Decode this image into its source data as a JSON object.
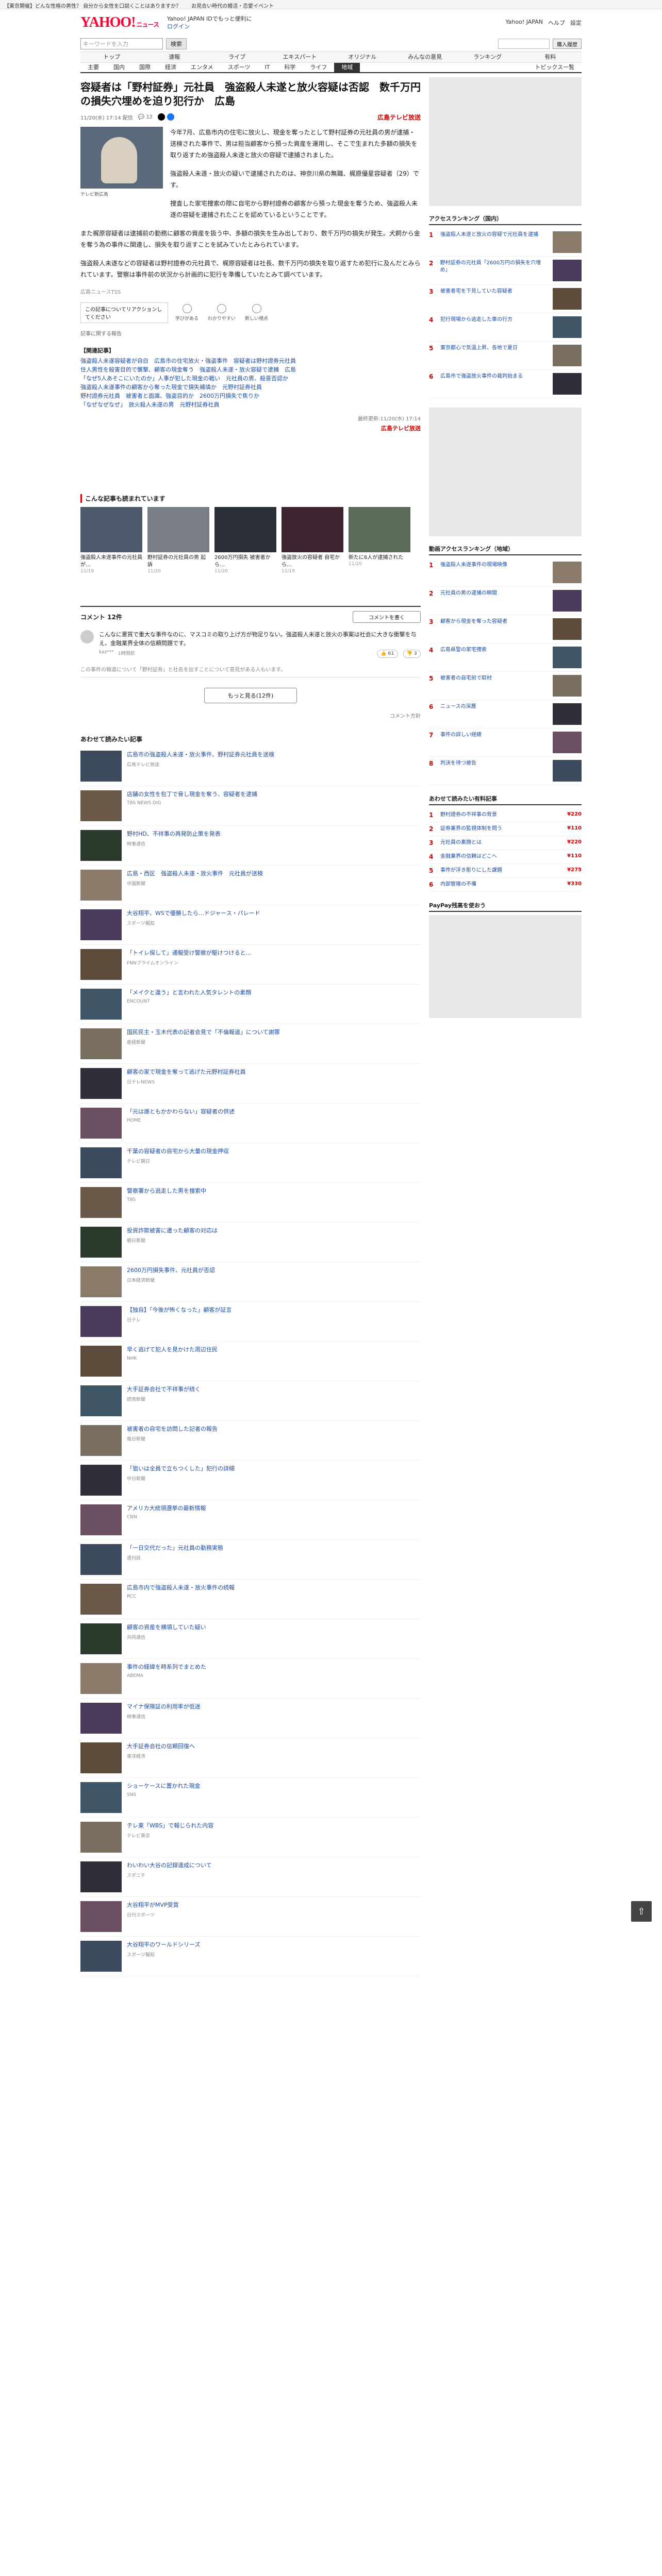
{
  "topbanner": {
    "left": "【東京開催】どんな性格の男性？ 自分から女性を口説くことはありますか？",
    "right": "お見合い時代の婚活・恋愛イベント"
  },
  "masthead": {
    "logo": "YAHOO!",
    "logo_sub": "ニュース",
    "links": [
      "Yahoo! JAPAN IDでもっと便利に",
      "ログイン"
    ],
    "right_links": [
      "Yahoo! JAPAN",
      "ヘルプ",
      "設定"
    ]
  },
  "search": {
    "placeholder": "キーワードを入力",
    "button": "検索",
    "right_button": "購入履歴"
  },
  "nav1": [
    "トップ",
    "速報",
    "ライブ",
    "エキスパート",
    "オリジナル",
    "みんなの意見",
    "ランキング",
    "有料"
  ],
  "nav2": {
    "items": [
      "主要",
      "国内",
      "国際",
      "経済",
      "エンタメ",
      "スポーツ",
      "IT",
      "科学",
      "ライフ",
      "地域"
    ],
    "active_index": 9,
    "favorite": "トピックス一覧"
  },
  "article": {
    "headline": "容疑者は「野村証券」元社員　強盗殺人未遂と放火容疑は否認　数千万円の損失穴埋めを迫り犯行か　広島",
    "date": "11/20(水) 17:14 配信",
    "comment_count": "12",
    "source": "広島テレビ放送",
    "photo_caption": "テレビ新広島",
    "paragraphs": [
      "今年7月、広島市内の住宅に放火し、現金を奪ったとして野村証券の元社員の男が逮捕・送検された事件で、男は担当顧客から預った資産を運用し、そこで生まれた多額の損失を取り返すため強盗殺人未遂と放火の容疑で逮捕されました。",
      "強盗殺人未遂・放火の疑いで逮捕されたのは、神奈川県の無職、梶原優星容疑者（29）です。",
      "捜査した家宅捜索の際に自宅から野村證券の顧客から預った現金を奪うため、強盗殺人未遂の容疑を逮捕されたことを認めているということです。"
    ],
    "full_paragraphs": [
      "また梶原容疑者は逮捕前の勤務に顧客の資産を扱う中、多額の損失を生み出しており、数千万円の損失が発生。犬飼から金を奪う為の事件に関連し、損失を取り返すことを試みていたとみられています。",
      "強盗殺人未遂などの容疑者は野村證券の元社員で、梶原容疑者は社長、数千万円の損失を取り返すため犯行に及んだとみられています。警察は事件前の状況から計画的に犯行を準備していたとみて調べています。"
    ],
    "small_source": "広島ニュースTSS",
    "reactions": {
      "prompt": "この記事についてリアクションしてください",
      "items": [
        "学びがある",
        "わかりやすい",
        "新しい視点"
      ]
    },
    "report": "記事に関する報告",
    "related_title": "【関連記事】",
    "related": [
      "強盗殺人未遂容疑者が自白　広島市の住宅放火・強盗事件　容疑者は野村證券元社員",
      "住人男性を殺害目的で襲撃、顧客の現金奪う　強盗殺人未遂・放火容疑で逮捕　広島",
      "「なぜ5人あそこにいたのか」人事が犯した現金の戦い　元社員の男、殺意否認か",
      "強盗殺人未遂事件の顧客から奪った現金で損失補填か　元野村証券社員",
      "野村證券元社員　被害者と面識、強盗目的か　2600万円損失で焦りか",
      "「なぜなぜなぜ」　放火殺人未遂の男　元野村証券社員"
    ],
    "footnote": "最終更新:11/20(水) 17:14",
    "brand_footer": "広島テレビ放送"
  },
  "also_read": {
    "title": "こんな記事も読まれています",
    "cards": [
      {
        "title": "強盗殺人未遂事件の元社員が…",
        "time": "11/19"
      },
      {
        "title": "野村証券の元社員の男 起訴",
        "time": "11/20"
      },
      {
        "title": "2600万円損失 被害者から…",
        "time": "11/20"
      },
      {
        "title": "強盗放火の容疑者 自宅から…",
        "time": "11/19"
      },
      {
        "title": "新たに6人が逮捕された",
        "time": "11/20"
      }
    ]
  },
  "comments": {
    "title": "コメント 12件",
    "write_button": "コメントを書く",
    "first": {
      "text": "こんなに悪質で重大な事件なのに、マスコミの取り上げ方が物足りない。強盗殺人未遂と放火の事案は社会に大きな衝撃を与え、金融業界全体の信頼問題です。",
      "user": "kaz***",
      "time": "1時間前",
      "likes": "61",
      "dislikes": "3"
    },
    "policy": "この事件の報道について「野村証券」と社名を出すことについて意見がある人もいます。",
    "more_button": "もっと見る(12件)",
    "policy_link": "コメント方針"
  },
  "more_list": {
    "title": "あわせて読みたい記事",
    "items": [
      {
        "title": "広島市の強盗殺人未遂・放火事件、野村証券元社員を送検",
        "meta": "広島テレビ放送"
      },
      {
        "title": "店舗の女性を包丁で脅し現金を奪う、容疑者を逮捕",
        "meta": "TBS NEWS DIG"
      },
      {
        "title": "野村HD、不祥事の再発防止策を発表",
        "meta": "時事通信"
      },
      {
        "title": "広島・西区　強盗殺人未遂・放火事件　元社員が送検",
        "meta": "中国新聞"
      },
      {
        "title": "大谷翔平、WSで優勝したら…ドジャース・パレード",
        "meta": "スポーツ報知"
      },
      {
        "title": "「トイレ探して」通報受け警察が駆けつけると…",
        "meta": "FNNプライムオンライン"
      },
      {
        "title": "「メイクと違う」と言われた人気タレントの素顔",
        "meta": "ENCOUNT"
      },
      {
        "title": "国民民主・玉木代表の記者会見で「不倫報道」について謝罪",
        "meta": "産経新聞"
      },
      {
        "title": "顧客の家で現金を奪って逃げた元野村証券社員",
        "meta": "日テレNEWS"
      },
      {
        "title": "「元は誰ともかかわらない」容疑者の供述",
        "meta": "HOME"
      },
      {
        "title": "千葉の容疑者の自宅から大量の現金押収",
        "meta": "テレビ朝日"
      },
      {
        "title": "警察署から逃走した男を捜索中",
        "meta": "TBS"
      },
      {
        "title": "投資詐欺被害に遭った顧客の対応は",
        "meta": "朝日新聞"
      },
      {
        "title": "2600万円損失事件、元社員が否認",
        "meta": "日本経済新聞"
      },
      {
        "title": "【独自】「今後が怖くなった」顧客が証言",
        "meta": "日テレ"
      },
      {
        "title": "早く逃げて犯人を見かけた周辺住民",
        "meta": "NHK"
      },
      {
        "title": "大手証券会社で不祥事が続く",
        "meta": "読売新聞"
      },
      {
        "title": "被害者の自宅を訪問した記者の報告",
        "meta": "毎日新聞"
      },
      {
        "title": "「狙いは全員で立ちつくした」犯行の詳細",
        "meta": "中日新聞"
      },
      {
        "title": "アメリカ大統領選挙の最新情報",
        "meta": "CNN"
      },
      {
        "title": "「一日交代だった」元社員の勤務実態",
        "meta": "週刊誌"
      },
      {
        "title": "広島市内で強盗殺人未遂・放火事件の続報",
        "meta": "RCC"
      },
      {
        "title": "顧客の資産を横領していた疑い",
        "meta": "共同通信"
      },
      {
        "title": "事件の経緯を時系列でまとめた",
        "meta": "ABEMA"
      },
      {
        "title": "マイナ保険証の利用率が低迷",
        "meta": "時事通信"
      },
      {
        "title": "大手証券会社の信頼回復へ",
        "meta": "東洋経済"
      },
      {
        "title": "ショーケースに置かれた現金",
        "meta": "SNS"
      },
      {
        "title": "テレ東「WBS」で報じられた内容",
        "meta": "テレビ東京"
      },
      {
        "title": "わいわい大谷の記録達成について",
        "meta": "スポニチ"
      },
      {
        "title": "大谷翔平がMVP受賞",
        "meta": "日刊スポーツ"
      },
      {
        "title": "大谷翔平のワールドシリーズ",
        "meta": "スポーツ報知"
      }
    ]
  },
  "side": {
    "access_title": "アクセスランキング（国内）",
    "access": [
      "強盗殺人未遂と放火の容疑で元社員を逮捕",
      "野村証券の元社員「2600万円の損失を穴埋め」",
      "被害者宅を下見していた容疑者",
      "犯行現場から逃走した車の行方",
      "東京都心で気温上昇、各地で夏日",
      "広島市で強盗放火事件の裁判始まる"
    ],
    "video_title": "動画アクセスランキング（地域）",
    "video": [
      "強盗殺人未遂事件の現場映像",
      "元社員の男の逮捕の瞬間",
      "顧客から現金を奪った容疑者",
      "広島県警の家宅捜索",
      "被害者の自宅前で取材",
      "ニュースの深層",
      "事件の詳しい経緯",
      "判決を待つ被告"
    ],
    "pick_title": "あわせて読みたい有料記事",
    "pick": [
      "野村證券の不祥事の背景",
      "証券業界の監視体制を問う",
      "元社員の素顔とは",
      "金融業界の信頼はどこへ",
      "事件が浮き彫りにした課題",
      "内部管理の不備"
    ],
    "pick_prices": [
      "¥220",
      "¥110",
      "¥220",
      "¥110",
      "¥275",
      "¥330"
    ],
    "paypay_title": "PayPay残高を使おう"
  }
}
